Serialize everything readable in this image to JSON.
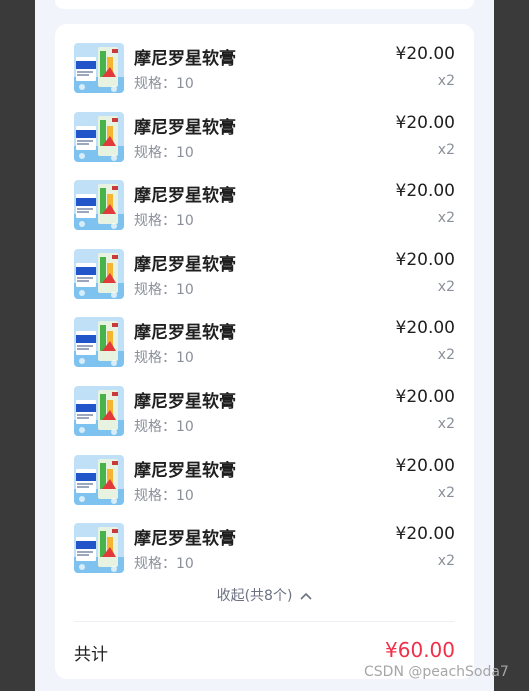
{
  "items": [
    {
      "name": "摩尼罗星软膏",
      "spec": "规格：10",
      "price": "¥20.00",
      "qty": "x2"
    },
    {
      "name": "摩尼罗星软膏",
      "spec": "规格：10",
      "price": "¥20.00",
      "qty": "x2"
    },
    {
      "name": "摩尼罗星软膏",
      "spec": "规格：10",
      "price": "¥20.00",
      "qty": "x2"
    },
    {
      "name": "摩尼罗星软膏",
      "spec": "规格：10",
      "price": "¥20.00",
      "qty": "x2"
    },
    {
      "name": "摩尼罗星软膏",
      "spec": "规格：10",
      "price": "¥20.00",
      "qty": "x2"
    },
    {
      "name": "摩尼罗星软膏",
      "spec": "规格：10",
      "price": "¥20.00",
      "qty": "x2"
    },
    {
      "name": "摩尼罗星软膏",
      "spec": "规格：10",
      "price": "¥20.00",
      "qty": "x2"
    },
    {
      "name": "摩尼罗星软膏",
      "spec": "规格：10",
      "price": "¥20.00",
      "qty": "x2"
    }
  ],
  "collapse_label": "收起(共8个)",
  "total_label": "共计",
  "total_value": "¥60.00",
  "watermark": "CSDN @peachSoda7",
  "colors": {
    "accent": "#f0304a",
    "page_bg": "#f1f5fb",
    "card_bg": "#ffffff",
    "outer_bg": "#3a3a3a"
  }
}
